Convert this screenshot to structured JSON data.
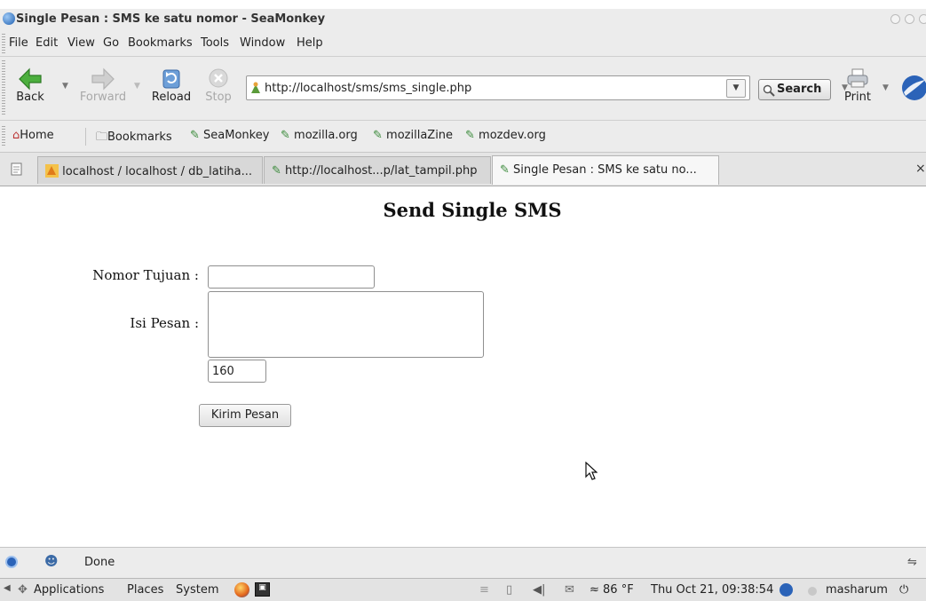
{
  "window": {
    "title": "Single Pesan : SMS ke satu nomor - SeaMonkey"
  },
  "menu": [
    "File",
    "Edit",
    "View",
    "Go",
    "Bookmarks",
    "Tools",
    "Window",
    "Help"
  ],
  "toolbar": {
    "back_label": "Back",
    "forward_label": "Forward",
    "reload_label": "Reload",
    "stop_label": "Stop",
    "url": "http://localhost/sms/sms_single.php",
    "search_label": "Search",
    "print_label": "Print"
  },
  "personal_toolbar": {
    "home": "Home",
    "bookmarks": "Bookmarks",
    "links": [
      "SeaMonkey",
      "mozilla.org",
      "mozillaZine",
      "mozdev.org"
    ]
  },
  "tabs": [
    {
      "label": "localhost / localhost / db_latiha...",
      "icon": "phpmyadmin-icon",
      "active": false
    },
    {
      "label": "http://localhost...p/lat_tampil.php",
      "icon": "bookmark-icon",
      "active": false
    },
    {
      "label": "Single Pesan : SMS ke satu no...",
      "icon": "bookmark-icon",
      "active": true
    }
  ],
  "tabbar_close": "×",
  "page": {
    "heading": "Send Single SMS",
    "label_number": "Nomor Tujuan :",
    "number_value": "",
    "label_message": "Isi Pesan :",
    "message_value": "",
    "counter_value": "160",
    "submit_label": "Kirim Pesan"
  },
  "status": {
    "text": "Done"
  },
  "panel": {
    "applications": "Applications",
    "places": "Places",
    "system": "System",
    "weather": "≈ 86 °F",
    "clock": "Thu Oct 21, 09:38:54",
    "user": "masharum"
  },
  "colors": {
    "chrome": "#ececec",
    "accent_blue": "#2b63b8",
    "link_green": "#3a8a3a"
  }
}
